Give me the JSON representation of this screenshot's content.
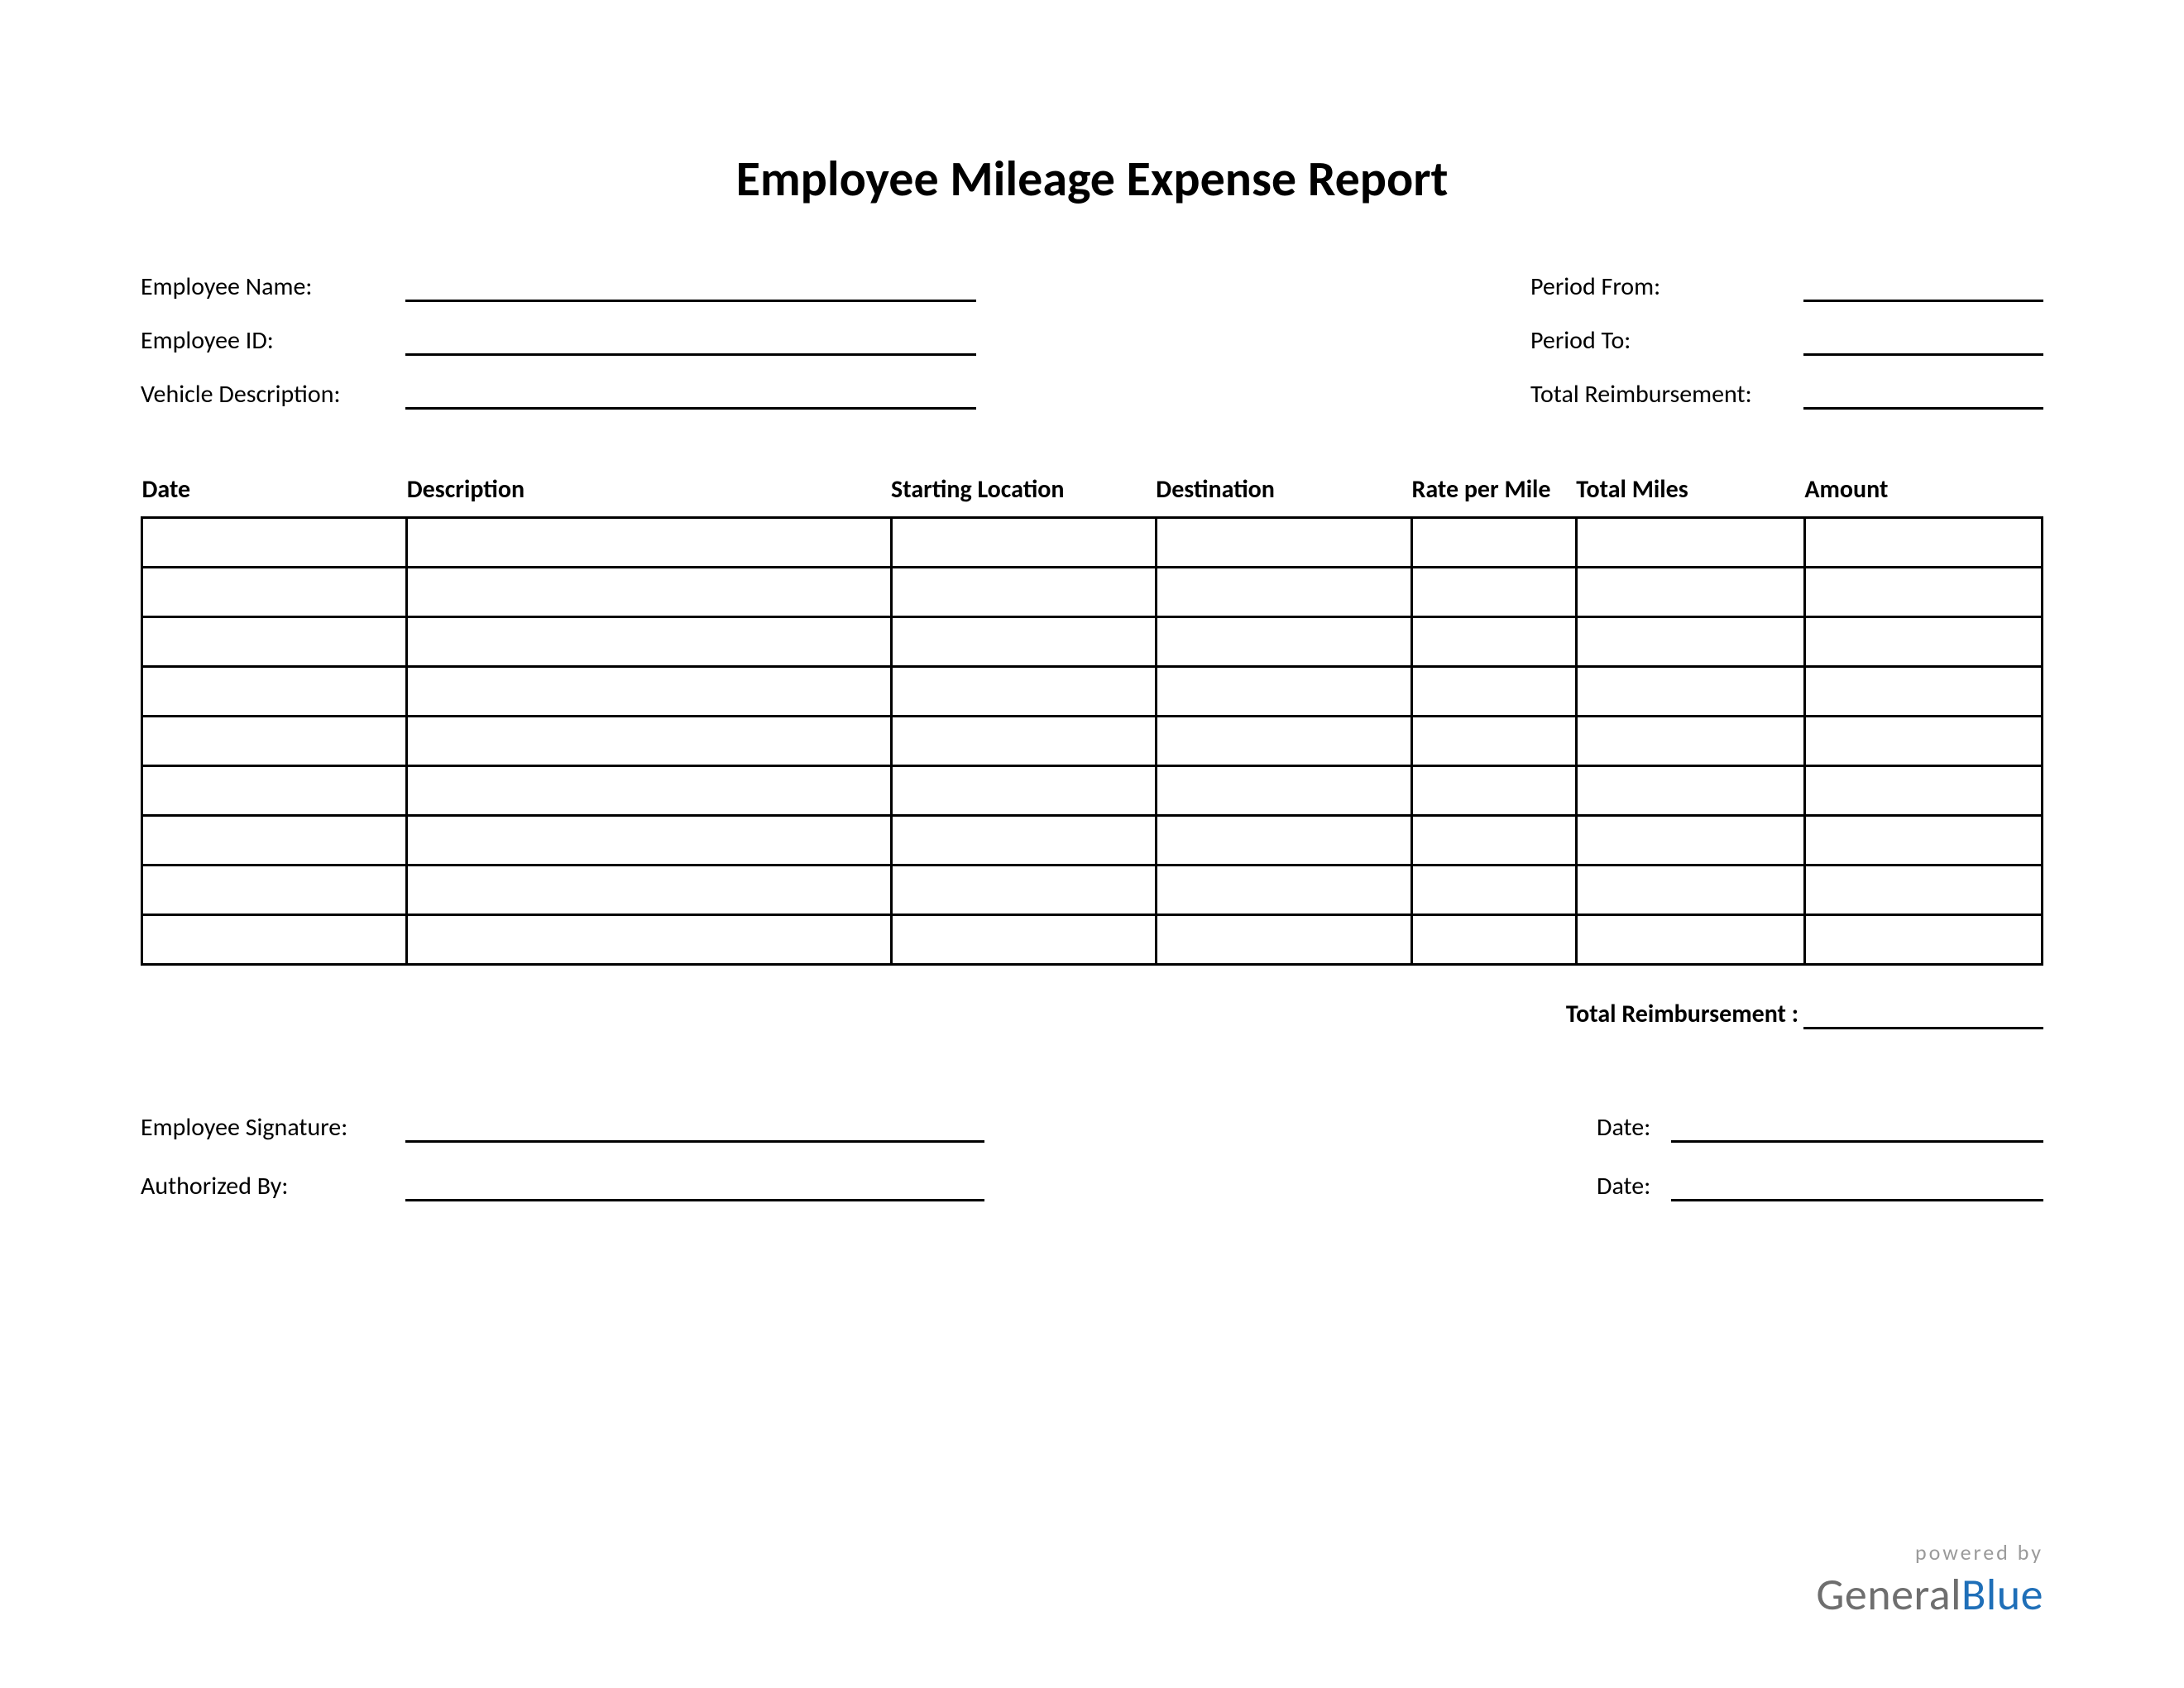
{
  "title": "Employee Mileage Expense Report",
  "info": {
    "left": [
      {
        "label": "Employee Name:",
        "value": ""
      },
      {
        "label": "Employee ID:",
        "value": ""
      },
      {
        "label": "Vehicle Description:",
        "value": ""
      }
    ],
    "right": [
      {
        "label": "Period From:",
        "value": ""
      },
      {
        "label": "Period To:",
        "value": ""
      },
      {
        "label": "Total Reimbursement:",
        "value": ""
      }
    ]
  },
  "table": {
    "headers": {
      "date": "Date",
      "description": "Description",
      "starting_location": "Starting Location",
      "destination": "Destination",
      "rate_per_mile": "Rate per Mile",
      "total_miles": "Total Miles",
      "amount": "Amount"
    },
    "rows": [
      {
        "date": "",
        "description": "",
        "starting_location": "",
        "destination": "",
        "rate_per_mile": "",
        "total_miles": "",
        "amount": ""
      },
      {
        "date": "",
        "description": "",
        "starting_location": "",
        "destination": "",
        "rate_per_mile": "",
        "total_miles": "",
        "amount": ""
      },
      {
        "date": "",
        "description": "",
        "starting_location": "",
        "destination": "",
        "rate_per_mile": "",
        "total_miles": "",
        "amount": ""
      },
      {
        "date": "",
        "description": "",
        "starting_location": "",
        "destination": "",
        "rate_per_mile": "",
        "total_miles": "",
        "amount": ""
      },
      {
        "date": "",
        "description": "",
        "starting_location": "",
        "destination": "",
        "rate_per_mile": "",
        "total_miles": "",
        "amount": ""
      },
      {
        "date": "",
        "description": "",
        "starting_location": "",
        "destination": "",
        "rate_per_mile": "",
        "total_miles": "",
        "amount": ""
      },
      {
        "date": "",
        "description": "",
        "starting_location": "",
        "destination": "",
        "rate_per_mile": "",
        "total_miles": "",
        "amount": ""
      },
      {
        "date": "",
        "description": "",
        "starting_location": "",
        "destination": "",
        "rate_per_mile": "",
        "total_miles": "",
        "amount": ""
      },
      {
        "date": "",
        "description": "",
        "starting_location": "",
        "destination": "",
        "rate_per_mile": "",
        "total_miles": "",
        "amount": ""
      }
    ]
  },
  "total": {
    "label": "Total Reimbursement :",
    "value": ""
  },
  "signatures": {
    "left": [
      {
        "label": "Employee Signature:",
        "value": ""
      },
      {
        "label": "Authorized By:",
        "value": ""
      }
    ],
    "right": [
      {
        "label": "Date:",
        "value": ""
      },
      {
        "label": "Date:",
        "value": ""
      }
    ]
  },
  "branding": {
    "powered": "powered by",
    "brand_a": "General",
    "brand_b": "Blue"
  }
}
